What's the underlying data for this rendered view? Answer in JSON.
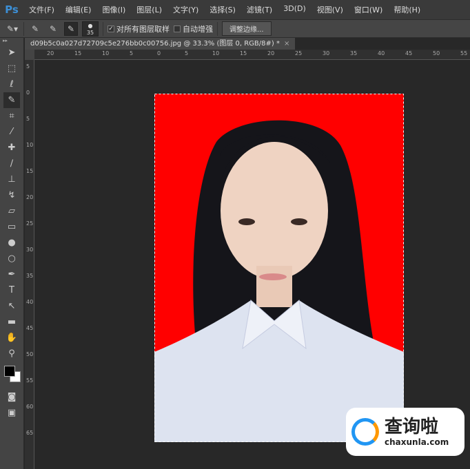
{
  "app": {
    "logo": "Ps"
  },
  "menu": [
    "文件(F)",
    "编辑(E)",
    "图像(I)",
    "图层(L)",
    "文字(Y)",
    "选择(S)",
    "滤镜(T)",
    "3D(D)",
    "视图(V)",
    "窗口(W)",
    "帮助(H)"
  ],
  "options": {
    "brush_size": "35",
    "sample_all_layers": "对所有图层取样",
    "sample_all_checked": true,
    "auto_enhance": "自动增强",
    "auto_enhance_checked": false,
    "refine_edge": "调整边缘..."
  },
  "document": {
    "tab_title": "d09b5c0a027d72709c5e276bb0c00756.jpg @ 33.3% (图层 0, RGB/8#) *",
    "close": "×"
  },
  "rulers": {
    "top": [
      "20",
      "15",
      "10",
      "5",
      "0",
      "5",
      "10",
      "15",
      "20",
      "25",
      "30",
      "35",
      "40",
      "45",
      "50",
      "55"
    ],
    "left": [
      "5",
      "0",
      "5",
      "10",
      "15",
      "20",
      "25",
      "30",
      "35",
      "40",
      "45",
      "50",
      "55",
      "60",
      "65"
    ]
  },
  "colors": {
    "background_fill": "#ff0000",
    "foreground": "#000000",
    "background": "#ffffff"
  },
  "watermark": {
    "cn": "查询啦",
    "url": "chaxunla.com"
  }
}
